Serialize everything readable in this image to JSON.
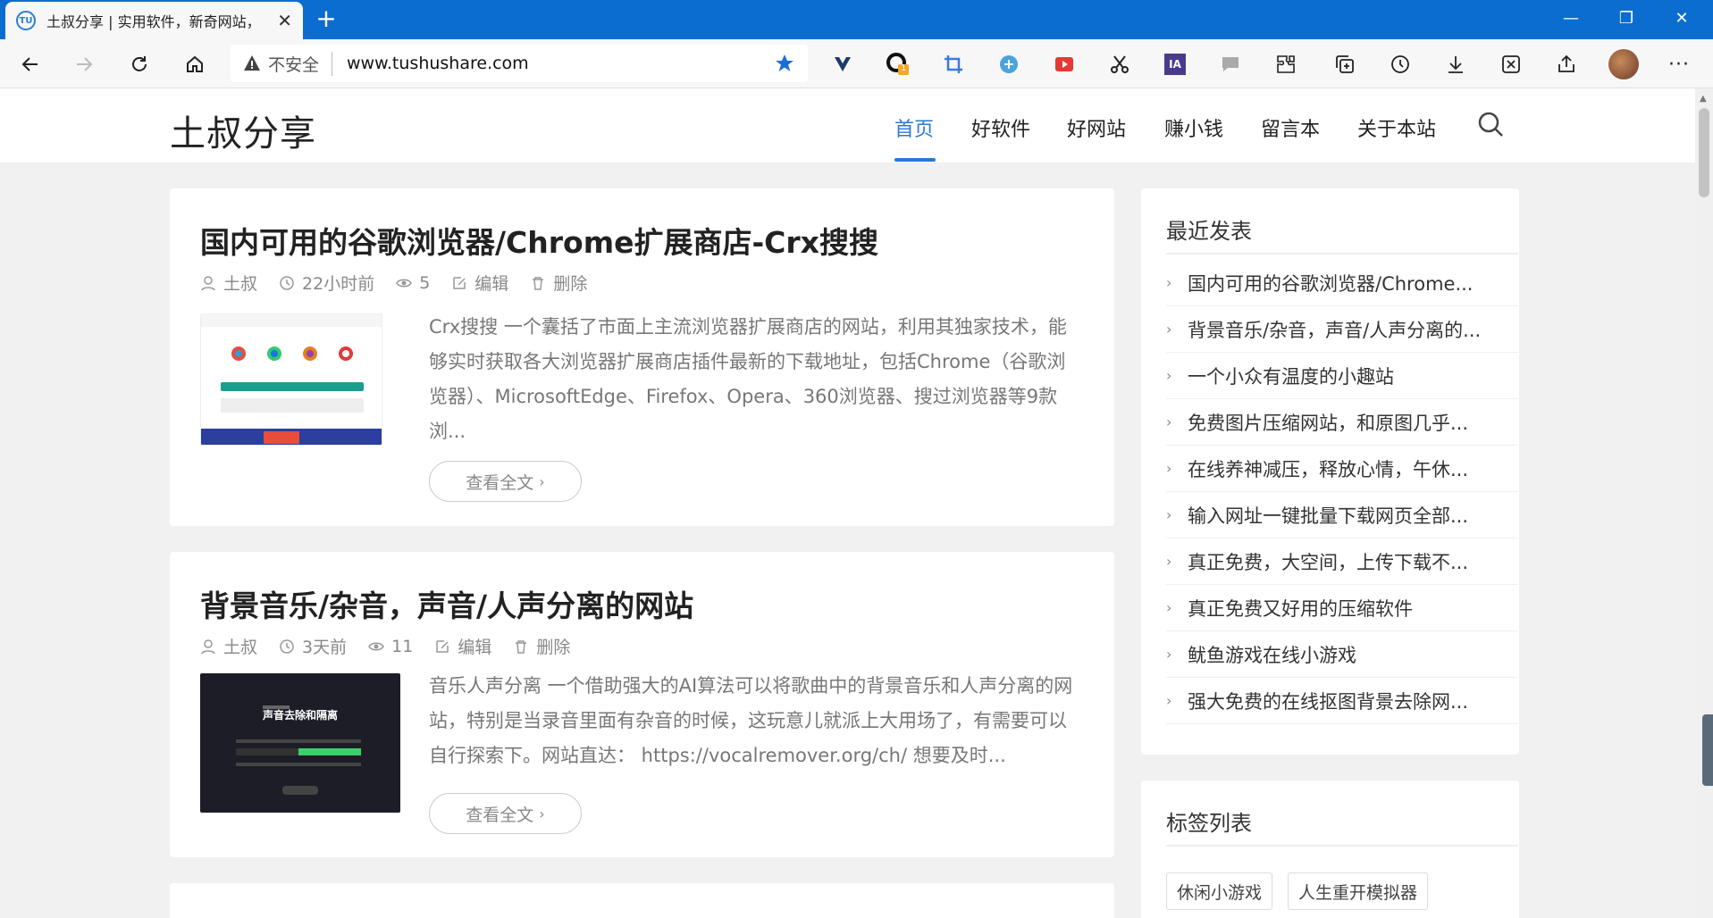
{
  "browser": {
    "tab_title": "土叔分享 | 实用软件，新奇网站，",
    "favicon_text": "TU",
    "insecure_label": "不安全",
    "url": "www.tushushare.com",
    "ext_badge": "1",
    "ext_ia_label": "IA"
  },
  "site": {
    "logo": "土叔分享",
    "nav": [
      "首页",
      "好软件",
      "好网站",
      "赚小钱",
      "留言本",
      "关于本站"
    ]
  },
  "posts": [
    {
      "title": "国内可用的谷歌浏览器/Chrome扩展商店-Crx搜搜",
      "author": "土叔",
      "time": "22小时前",
      "views": "5",
      "edit": "编辑",
      "delete": "删除",
      "excerpt": "Crx搜搜 一个囊括了市面上主流浏览器扩展商店的网站，利用其独家技术，能够实时获取各大浏览器扩展商店插件最新的下载地址，包括Chrome（谷歌浏览器）、MicrosoftEdge、Firefox、Opera、360浏览器、搜过浏览器等9款浏...",
      "readmore": "查看全文"
    },
    {
      "title": "背景音乐/杂音，声音/人声分离的网站",
      "author": "土叔",
      "time": "3天前",
      "views": "11",
      "edit": "编辑",
      "delete": "删除",
      "excerpt": "音乐人声分离 一个借助强大的AI算法可以将歌曲中的背景音乐和人声分离的网站，特别是当录音里面有杂音的时候，这玩意儿就派上大用场了，有需要可以自行探索下。网站直达： https://vocalremover.org/ch/ 想要及时...",
      "readmore": "查看全文",
      "thumb_text": "声音去除和隔离"
    }
  ],
  "sidebar": {
    "recent_title": "最近发表",
    "recent": [
      "国内可用的谷歌浏览器/Chrome...",
      "背景音乐/杂音，声音/人声分离的...",
      "一个小众有温度的小趣站",
      "免费图片压缩网站，和原图几乎...",
      "在线养神减压，释放心情，午休...",
      "输入网址一键批量下载网页全部...",
      "真正免费，大空间，上传下载不...",
      "真正免费又好用的压缩软件",
      "鱿鱼游戏在线小游戏",
      "强大免费的在线抠图背景去除网..."
    ],
    "tags_title": "标签列表",
    "tags": [
      "休闲小游戏",
      "人生重开模拟器"
    ]
  }
}
